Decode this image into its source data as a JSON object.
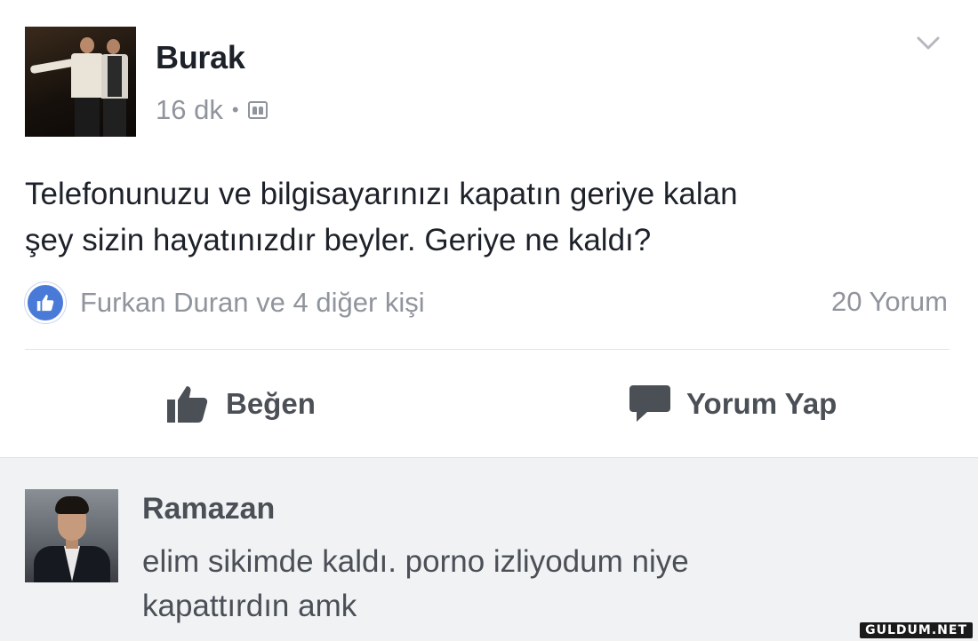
{
  "post": {
    "author": "Burak",
    "time": "16 dk",
    "separator": "•",
    "audience_icon": "friends-icon",
    "menu_icon": "chevron-down-icon",
    "text_lines": [
      "Telefonunuzu ve bilgisayarınızı kapatın geriye kalan",
      "şey sizin hayatınızdır beyler. Geriye ne kaldı?"
    ],
    "reactions_label": "Furkan Duran ve 4 diğer kişi",
    "comment_count": "20 Yorum",
    "actions": {
      "like_label": "Beğen",
      "comment_label": "Yorum Yap"
    }
  },
  "comment": {
    "author": "Ramazan",
    "text_lines": [
      "elim sikimde kaldı. porno izliyodum niye",
      "kapattırdın amk"
    ]
  },
  "watermark": "GULDUM.NET",
  "colors": {
    "like_blue": "#4a7ad8",
    "text_dark": "#1d2129",
    "text_muted": "#90949c",
    "comment_bg": "#f0f2f4"
  }
}
